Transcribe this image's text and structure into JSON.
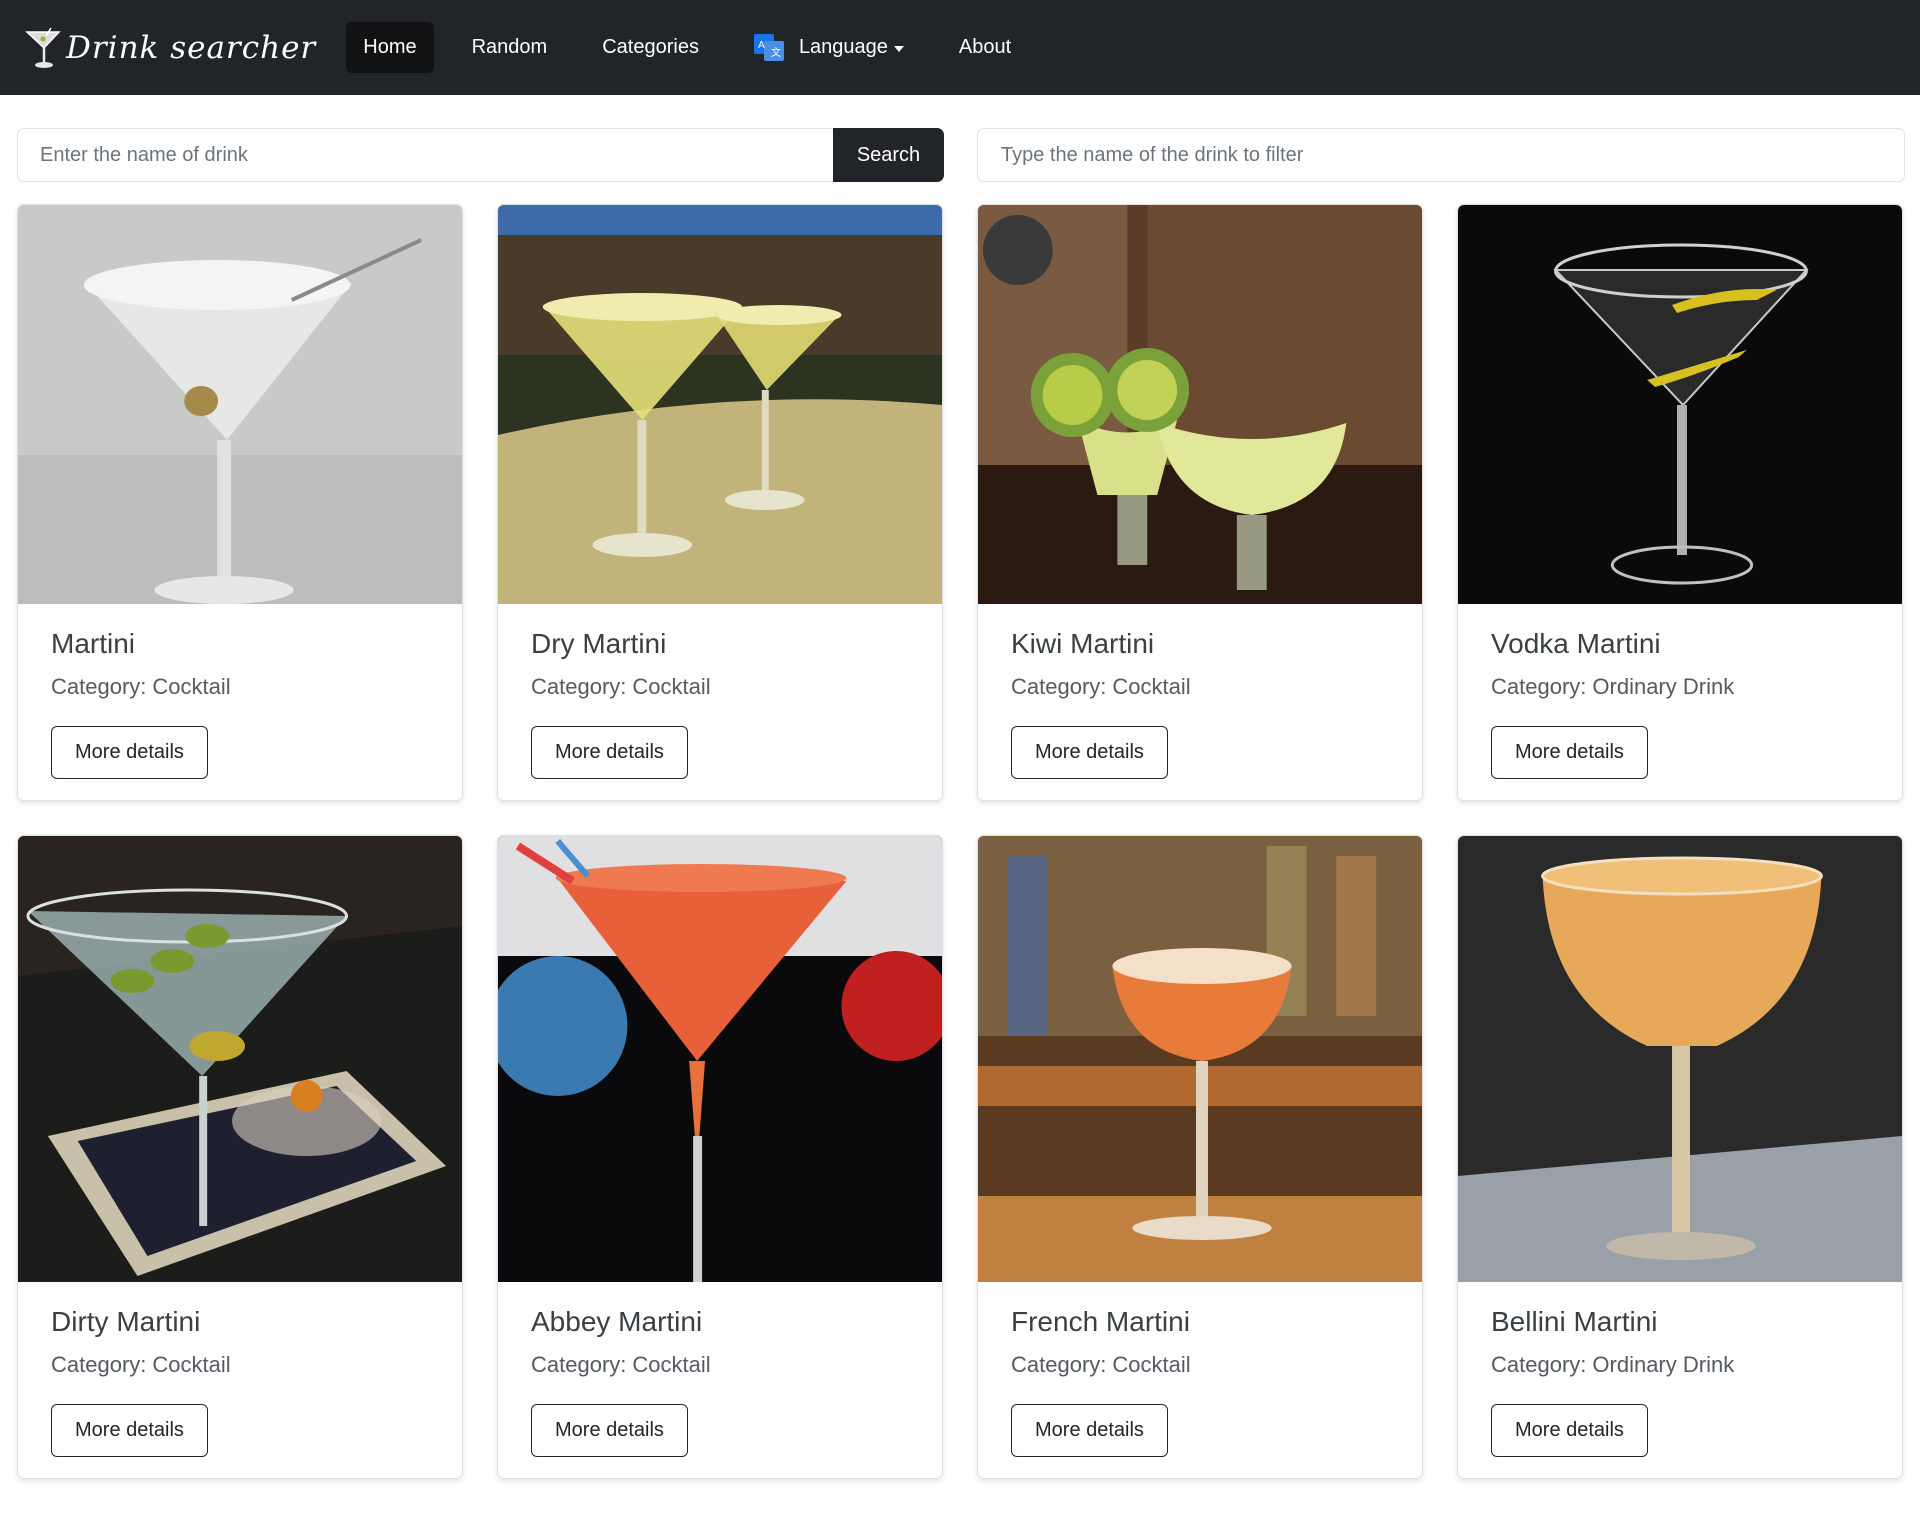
{
  "navbar": {
    "brand": "Drink searcher",
    "links": {
      "home": "Home",
      "random": "Random",
      "categories": "Categories",
      "language": "Language",
      "about": "About"
    },
    "active": "Home",
    "icons": {
      "brand": "martini-glass-icon",
      "language": "translate-icon",
      "dropdown": "caret-down-icon"
    }
  },
  "search": {
    "placeholder": "Enter the name of drink",
    "value": "",
    "button_label": "Search"
  },
  "filter": {
    "placeholder": "Type the name of the drink to filter",
    "value": ""
  },
  "card_labels": {
    "category_prefix": "Category:",
    "details_button": "More details"
  },
  "drinks": [
    {
      "name": "Martini",
      "category": "Cocktail"
    },
    {
      "name": "Dry Martini",
      "category": "Cocktail"
    },
    {
      "name": "Kiwi Martini",
      "category": "Cocktail"
    },
    {
      "name": "Vodka Martini",
      "category": "Ordinary Drink"
    },
    {
      "name": "Dirty Martini",
      "category": "Cocktail"
    },
    {
      "name": "Abbey Martini",
      "category": "Cocktail"
    },
    {
      "name": "French Martini",
      "category": "Cocktail"
    },
    {
      "name": "Bellini Martini",
      "category": "Ordinary Drink"
    }
  ],
  "colors": {
    "navbar_bg": "#212529",
    "nav_active_bg": "#101214",
    "button_dark": "#212529",
    "card_border": "#dee2e6"
  }
}
